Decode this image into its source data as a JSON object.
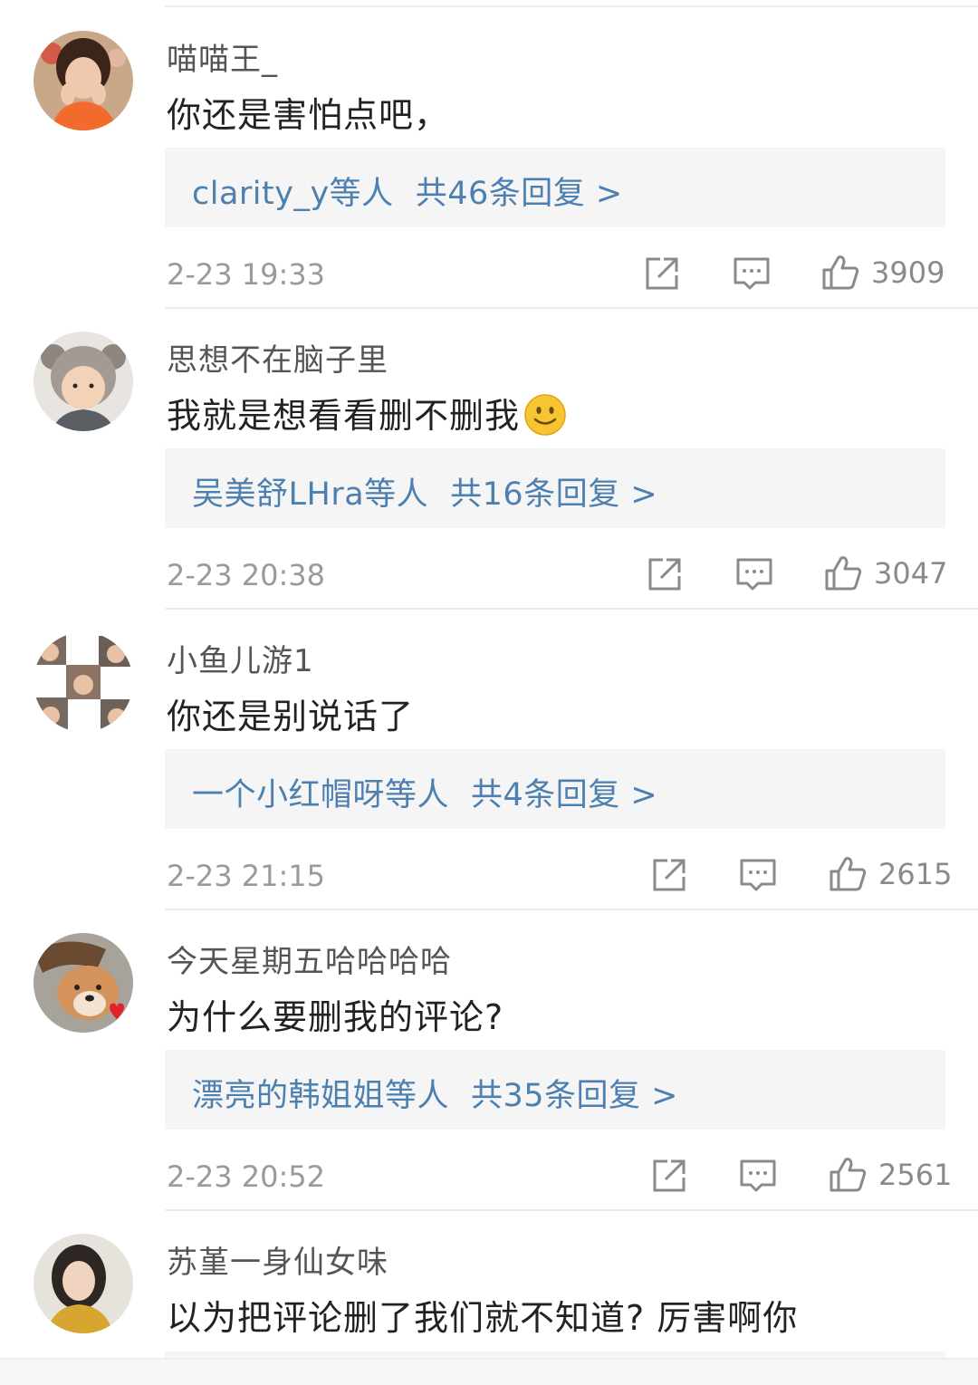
{
  "comments": [
    {
      "username": "喵喵王_",
      "text": "你还是害怕点吧，",
      "emoji": "",
      "reply_users": "clarity_y等人",
      "reply_count": "共46条回复 >",
      "timestamp": "2-23 19:33",
      "likes": "3909",
      "avatar_icon": "avatar-girl-icon"
    },
    {
      "username": "思想不在脑子里",
      "text": "我就是想看看删不删我",
      "emoji": "smile-emoji-icon",
      "reply_users": "吴美舒LHra等人",
      "reply_count": "共16条回复 >",
      "timestamp": "2-23 20:38",
      "likes": "3047",
      "avatar_icon": "avatar-child-bear-hat-icon"
    },
    {
      "username": "小鱼儿游1",
      "text": "你还是别说话了",
      "emoji": "",
      "reply_users": "一个小红帽呀等人",
      "reply_count": "共4条回复 >",
      "timestamp": "2-23 21:15",
      "likes": "2615",
      "avatar_icon": "avatar-collage-icon"
    },
    {
      "username": "今天星期五哈哈哈哈",
      "text": "为什么要删我的评论?",
      "emoji": "",
      "reply_users": "漂亮的韩姐姐等人",
      "reply_count": "共35条回复 >",
      "timestamp": "2-23 20:52",
      "likes": "2561",
      "avatar_icon": "avatar-dog-icon"
    },
    {
      "username": "苏堇一身仙女味",
      "text": "以为把评论删了我们就不知道?  厉害啊你",
      "emoji": "",
      "avatar_icon": "avatar-woman-icon"
    }
  ],
  "icons": {
    "share": "share-icon",
    "comment": "comment-icon",
    "like": "thumbs-up-icon"
  },
  "colors": {
    "reply_link": "#4d80b0",
    "reply_bg": "#f5f5f5",
    "meta_gray": "#9a9a9a"
  }
}
